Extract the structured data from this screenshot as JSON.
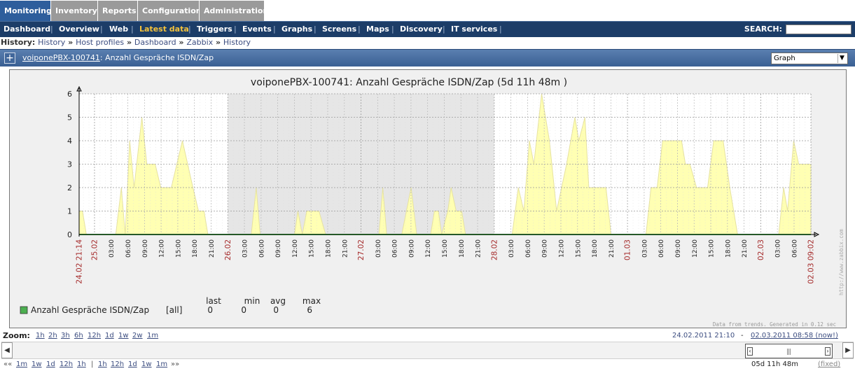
{
  "main_tabs": [
    {
      "label": "Monitoring",
      "active": true
    },
    {
      "label": "Inventory",
      "active": false
    },
    {
      "label": "Reports",
      "active": false
    },
    {
      "label": "Configuration",
      "active": false
    },
    {
      "label": "Administration",
      "active": false
    }
  ],
  "sub_menu": [
    {
      "label": "Dashboard",
      "active": false
    },
    {
      "label": "Overview",
      "active": false
    },
    {
      "label": "Web",
      "active": false
    },
    {
      "label": "Latest data",
      "active": true
    },
    {
      "label": "Triggers",
      "active": false
    },
    {
      "label": "Events",
      "active": false
    },
    {
      "label": "Graphs",
      "active": false
    },
    {
      "label": "Screens",
      "active": false
    },
    {
      "label": "Maps",
      "active": false
    },
    {
      "label": "Discovery",
      "active": false
    },
    {
      "label": "IT services",
      "active": false
    }
  ],
  "search": {
    "label": "SEARCH:",
    "value": ""
  },
  "history": {
    "label": "History:",
    "crumbs": [
      "History",
      "Host profiles",
      "Dashboard",
      "Zabbix",
      "History"
    ]
  },
  "title_bar": {
    "host_link": "voiponePBX-100741",
    "item_name": ": Anzahl Gespräche ISDN/Zap",
    "view_select": "Graph"
  },
  "legend": {
    "headers": [
      "last",
      "min",
      "avg",
      "max"
    ],
    "item": "Anzahl Gespräche ISDN/Zap",
    "func": "[all]",
    "values": [
      "0",
      "0",
      "0",
      "6"
    ],
    "color": "#4caf50"
  },
  "footer_note": "Data from trends. Generated in 0.12 sec",
  "watermark": "http://www.zabbix.com",
  "zoom": {
    "label": "Zoom:",
    "links": [
      "1h",
      "2h",
      "3h",
      "6h",
      "12h",
      "1d",
      "1w",
      "2w",
      "1m"
    ]
  },
  "period": {
    "from": "24.02.2011 21:10",
    "dash": "-",
    "to": "02.03.2011 08:58 (now!)",
    "length": "05d 11h 48m",
    "fixed": "(fixed)"
  },
  "nav": {
    "back_sym": "««",
    "back_links": [
      "1m",
      "1w",
      "1d",
      "12h",
      "1h"
    ],
    "divider": "|",
    "fwd_links": [
      "1h",
      "12h",
      "1d",
      "1w",
      "1m"
    ],
    "fwd_sym": "»»"
  },
  "colors": {
    "fill": "#ffffb3",
    "line": "#e6e2a0",
    "baseline": "#4caf50",
    "weekend": "#e6e6e6",
    "day_label": "#a52a2a"
  },
  "chart_data": {
    "type": "area",
    "title": "voiponePBX-100741: Anzahl Gespräche ISDN/Zap  (5d 11h 48m )",
    "x_unit": "hours since 24.02 21:14",
    "ylim": [
      0,
      6
    ],
    "y_ticks": [
      0,
      1,
      2,
      3,
      4,
      5,
      6
    ],
    "grid": true,
    "x_tick_labels": [
      {
        "label": "24.02 21:14",
        "h": 0,
        "day": true
      },
      {
        "label": "25.02",
        "h": 2.77,
        "day": true
      },
      {
        "label": "03:00",
        "h": 5.77
      },
      {
        "label": "06:00",
        "h": 8.77
      },
      {
        "label": "09:00",
        "h": 11.77
      },
      {
        "label": "12:00",
        "h": 14.77
      },
      {
        "label": "15:00",
        "h": 17.77
      },
      {
        "label": "18:00",
        "h": 20.77
      },
      {
        "label": "21:00",
        "h": 23.77
      },
      {
        "label": "26.02",
        "h": 26.77,
        "day": true
      },
      {
        "label": "03:00",
        "h": 29.77
      },
      {
        "label": "06:00",
        "h": 32.77
      },
      {
        "label": "09:00",
        "h": 35.77
      },
      {
        "label": "12:00",
        "h": 38.77
      },
      {
        "label": "15:00",
        "h": 41.77
      },
      {
        "label": "18:00",
        "h": 44.77
      },
      {
        "label": "21:00",
        "h": 47.77
      },
      {
        "label": "27.02",
        "h": 50.77,
        "day": true
      },
      {
        "label": "03:00",
        "h": 53.77
      },
      {
        "label": "06:00",
        "h": 56.77
      },
      {
        "label": "09:00",
        "h": 59.77
      },
      {
        "label": "12:00",
        "h": 62.77
      },
      {
        "label": "15:00",
        "h": 65.77
      },
      {
        "label": "18:00",
        "h": 68.77
      },
      {
        "label": "21:00",
        "h": 71.77
      },
      {
        "label": "28.02",
        "h": 74.77,
        "day": true
      },
      {
        "label": "03:00",
        "h": 77.77
      },
      {
        "label": "06:00",
        "h": 80.77
      },
      {
        "label": "09:00",
        "h": 83.77
      },
      {
        "label": "12:00",
        "h": 86.77
      },
      {
        "label": "15:00",
        "h": 89.77
      },
      {
        "label": "18:00",
        "h": 92.77
      },
      {
        "label": "21:00",
        "h": 95.77
      },
      {
        "label": "01.03",
        "h": 98.77,
        "day": true
      },
      {
        "label": "03:00",
        "h": 101.77
      },
      {
        "label": "06:00",
        "h": 104.77
      },
      {
        "label": "09:00",
        "h": 107.77
      },
      {
        "label": "12:00",
        "h": 110.77
      },
      {
        "label": "15:00",
        "h": 113.77
      },
      {
        "label": "18:00",
        "h": 116.77
      },
      {
        "label": "21:00",
        "h": 119.77
      },
      {
        "label": "02.03",
        "h": 122.77,
        "day": true
      },
      {
        "label": "03:00",
        "h": 125.77
      },
      {
        "label": "06:00",
        "h": 128.77
      },
      {
        "label": "02.03 09:02",
        "h": 131.8,
        "day": true
      }
    ],
    "weekend_hours": [
      26.77,
      74.77
    ],
    "x_max_hours": 131.8,
    "series": [
      {
        "name": "Anzahl Gespräche ISDN/Zap",
        "points": [
          [
            0,
            1
          ],
          [
            0.6,
            1
          ],
          [
            1.3,
            0
          ],
          [
            6.6,
            0
          ],
          [
            7.6,
            2
          ],
          [
            8.3,
            0
          ],
          [
            9.1,
            4
          ],
          [
            9.9,
            2
          ],
          [
            11.3,
            5
          ],
          [
            12.2,
            3
          ],
          [
            13.7,
            3
          ],
          [
            14.7,
            2
          ],
          [
            16.6,
            2
          ],
          [
            18.6,
            4
          ],
          [
            20.5,
            2
          ],
          [
            21.5,
            1
          ],
          [
            22.5,
            1
          ],
          [
            23.2,
            0
          ],
          [
            31.0,
            0
          ],
          [
            31.9,
            2
          ],
          [
            32.6,
            0
          ],
          [
            38.8,
            0
          ],
          [
            39.4,
            1
          ],
          [
            40.2,
            0
          ],
          [
            41.0,
            1
          ],
          [
            43.2,
            1
          ],
          [
            44.4,
            0
          ],
          [
            54.0,
            0
          ],
          [
            54.7,
            2
          ],
          [
            55.4,
            0
          ],
          [
            58.1,
            0
          ],
          [
            59.8,
            2
          ],
          [
            60.8,
            0
          ],
          [
            63.3,
            0
          ],
          [
            64.0,
            1
          ],
          [
            64.7,
            1
          ],
          [
            65.3,
            0
          ],
          [
            66.4,
            1
          ],
          [
            67.0,
            2
          ],
          [
            67.9,
            1
          ],
          [
            68.9,
            1
          ],
          [
            69.6,
            0
          ],
          [
            78.0,
            0
          ],
          [
            79.1,
            2
          ],
          [
            80.1,
            1
          ],
          [
            81.1,
            4
          ],
          [
            81.9,
            3
          ],
          [
            83.3,
            6
          ],
          [
            84.7,
            4
          ],
          [
            86.0,
            1
          ],
          [
            87.8,
            3
          ],
          [
            89.3,
            5
          ],
          [
            90.0,
            4
          ],
          [
            91.1,
            5
          ],
          [
            91.8,
            2
          ],
          [
            94.9,
            2
          ],
          [
            95.8,
            0
          ],
          [
            102.1,
            0
          ],
          [
            103.0,
            2
          ],
          [
            104.1,
            2
          ],
          [
            105.1,
            4
          ],
          [
            108.5,
            4
          ],
          [
            109.2,
            3
          ],
          [
            110.0,
            3
          ],
          [
            111.2,
            2
          ],
          [
            113.2,
            2
          ],
          [
            114.3,
            4
          ],
          [
            116.0,
            4
          ],
          [
            117.2,
            2
          ],
          [
            118.6,
            0
          ],
          [
            126.0,
            0
          ],
          [
            126.9,
            2
          ],
          [
            127.6,
            1
          ],
          [
            128.7,
            4
          ],
          [
            129.6,
            3
          ],
          [
            131.8,
            3
          ]
        ]
      }
    ]
  }
}
